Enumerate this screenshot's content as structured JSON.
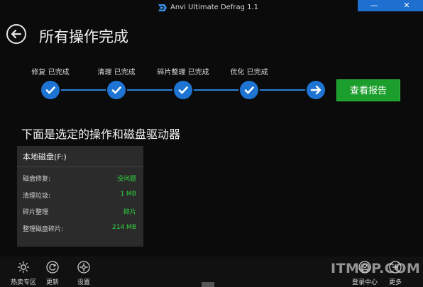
{
  "window": {
    "title": "Anvi Ultimate Defrag 1.1",
    "minimize_glyph": "—",
    "close_glyph": "✕"
  },
  "header": {
    "title": "所有操作完成"
  },
  "steps": [
    {
      "label": "修复 已完成",
      "icon": "check-icon"
    },
    {
      "label": "清理 已完成",
      "icon": "check-icon"
    },
    {
      "label": "碎片整理 已完成",
      "icon": "check-icon"
    },
    {
      "label": "优化 已完成",
      "icon": "check-icon"
    }
  ],
  "report_button": "查看报告",
  "section_heading": "下面是选定的操作和磁盘驱动器",
  "disk_panel": {
    "title": "本地磁盘(F:)",
    "rows": [
      {
        "label": "磁盘修复:",
        "value": "没问题"
      },
      {
        "label": "清理垃圾:",
        "value": "1 MB"
      },
      {
        "label": "碎片整理",
        "value": "碎片"
      },
      {
        "label": "整理磁盘碎片:",
        "value": "214 MB"
      }
    ]
  },
  "bottom_bar": {
    "left": [
      {
        "label": "热卖专区",
        "icon": "sun-icon"
      },
      {
        "label": "更新",
        "icon": "refresh-icon"
      },
      {
        "label": "设置",
        "icon": "gear-icon"
      }
    ],
    "right": [
      {
        "label": "登录中心",
        "icon": "user-icon"
      },
      {
        "label": "更多",
        "icon": "plus-icon"
      }
    ]
  },
  "watermark": "ITMOP.COM",
  "colors": {
    "accent_blue": "#1e74d2",
    "success_green": "#1c9e2c",
    "value_green": "#2fd63f",
    "background": "#0b0b0b"
  }
}
